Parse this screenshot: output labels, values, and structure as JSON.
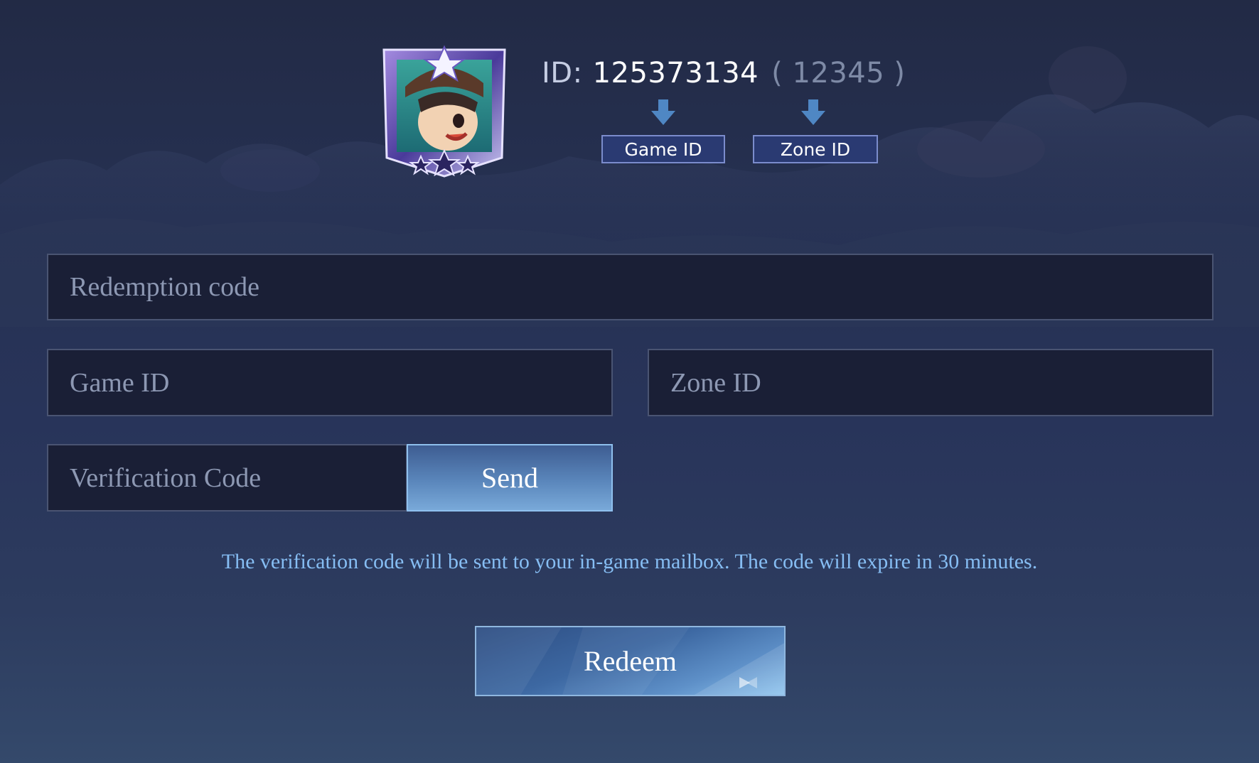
{
  "header": {
    "id_prefix": "ID:",
    "game_id_value": "125373134",
    "zone_open": "(",
    "zone_id_value": "12345",
    "zone_close": ")",
    "game_id_tag": "Game ID",
    "zone_id_tag": "Zone ID",
    "avatar_icon": "hero-avatar-icon",
    "arrow_icon": "arrow-down-icon"
  },
  "form": {
    "redemption_placeholder": "Redemption code",
    "game_id_placeholder": "Game ID",
    "zone_id_placeholder": "Zone ID",
    "verification_placeholder": "Verification Code",
    "send_label": "Send",
    "notice": "The verification code will be sent to your in-game mailbox. The code will expire in 30 minutes.",
    "redeem_label": "Redeem"
  },
  "colors": {
    "background": "#28345a",
    "field_background": "#1a1f36",
    "notice_text": "#86bdf3",
    "button_accent": "#5a86bb"
  }
}
